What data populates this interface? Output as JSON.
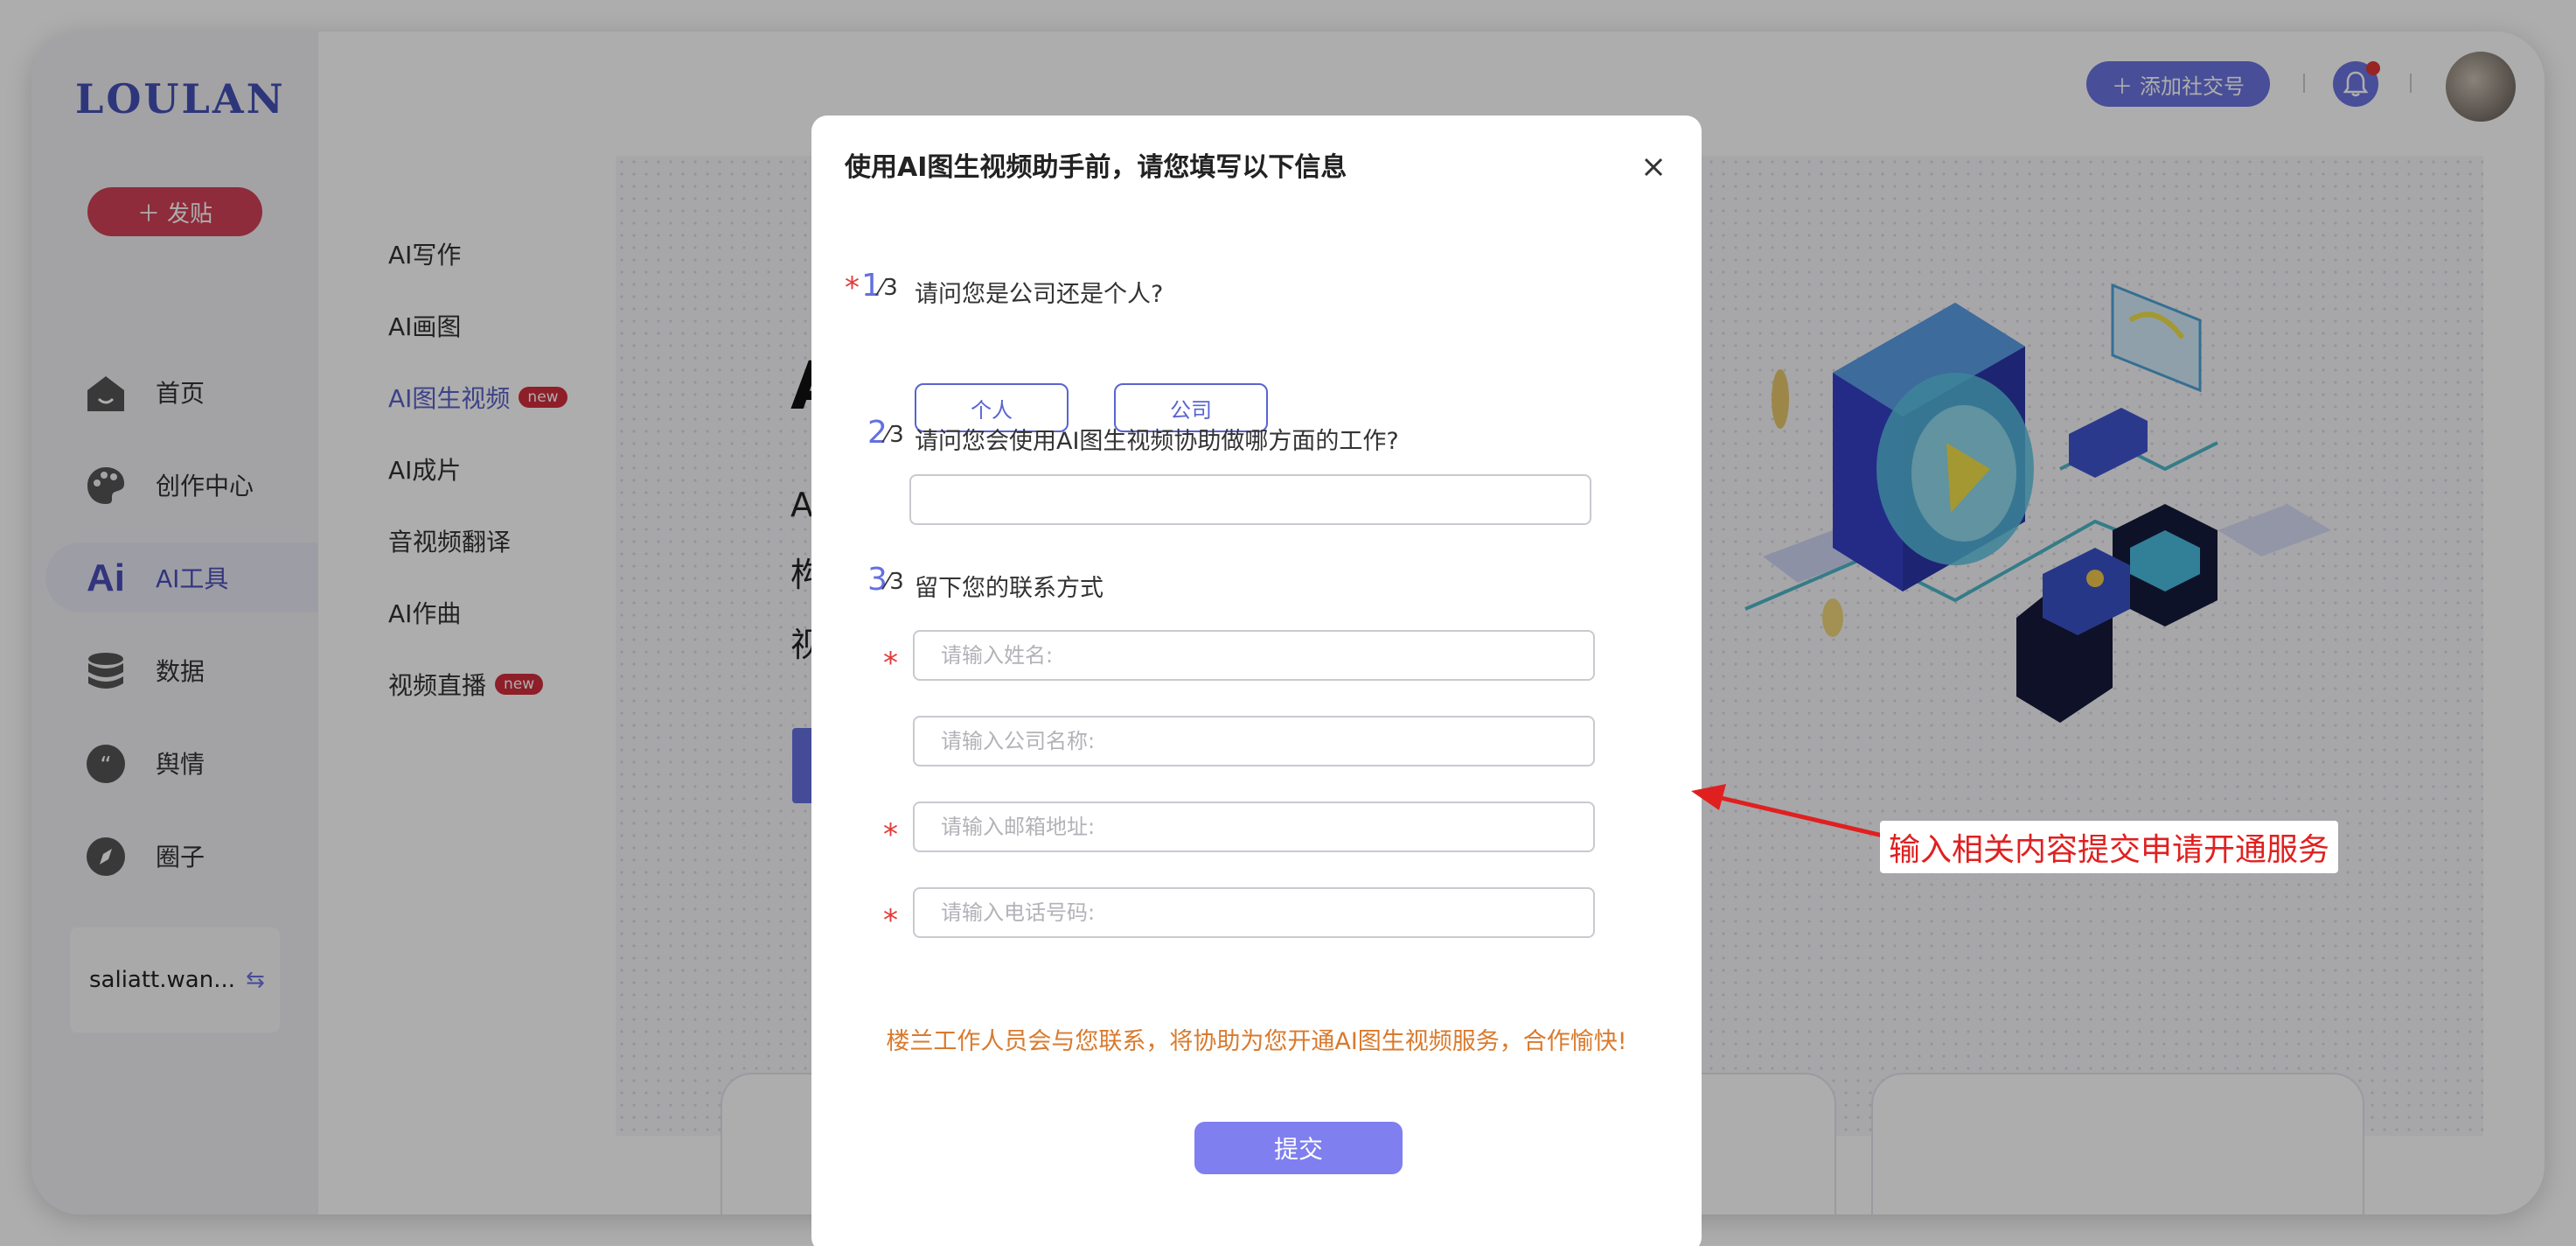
{
  "app": {
    "logo": "LOULAN",
    "post_button": "发贴",
    "nav": [
      {
        "label": "首页",
        "icon": "home-icon"
      },
      {
        "label": "创作中心",
        "icon": "palette-icon"
      },
      {
        "label": "AI工具",
        "icon": "ai-icon",
        "active": true
      },
      {
        "label": "数据",
        "icon": "database-icon"
      },
      {
        "label": "舆情",
        "icon": "quote-icon"
      },
      {
        "label": "圈子",
        "icon": "compass-icon"
      }
    ],
    "ai_icon_text": "Ai",
    "user_name": "saliatt.wan...",
    "submenu": [
      {
        "label": "AI写作"
      },
      {
        "label": "AI画图"
      },
      {
        "label": "AI图生视频",
        "badge": "new",
        "active": true
      },
      {
        "label": "AI成片"
      },
      {
        "label": "音视频翻译"
      },
      {
        "label": "AI作曲"
      },
      {
        "label": "视频直播",
        "badge": "new"
      }
    ],
    "topbar": {
      "add_social_label": "添加社交号"
    },
    "background": {
      "title_partial": "A",
      "lines": [
        "AI图",
        "构，",
        "视频"
      ]
    }
  },
  "modal": {
    "title": "使用AI图生视频助手前，请您填写以下信息",
    "steps": [
      {
        "num": "1",
        "den": "3",
        "question": "请问您是公司还是个人?",
        "required": true
      },
      {
        "num": "2",
        "den": "3",
        "question": "请问您会使用AI图生视频协助做哪方面的工作?",
        "required": false
      },
      {
        "num": "3",
        "den": "3",
        "question": "留下您的联系方式",
        "required": false
      }
    ],
    "choices": [
      "个人",
      "公司"
    ],
    "work_field_value": "",
    "fields": [
      {
        "placeholder": "请输入姓名:",
        "required": true
      },
      {
        "placeholder": "请输入公司名称:",
        "required": false
      },
      {
        "placeholder": "请输入邮箱地址:",
        "required": true
      },
      {
        "placeholder": "请输入电话号码:",
        "required": true
      }
    ],
    "notice": "楼兰工作人员会与您联系，将协助为您开通AI图生视频服务，合作愉快!",
    "submit_label": "提交"
  },
  "annotation": {
    "text": "输入相关内容提交申请开通服务",
    "color": "#e02020"
  },
  "colors": {
    "accent": "#6a73e0",
    "post_button": "#d24257",
    "submit": "#7f7fef",
    "notice": "#d97a2d"
  }
}
